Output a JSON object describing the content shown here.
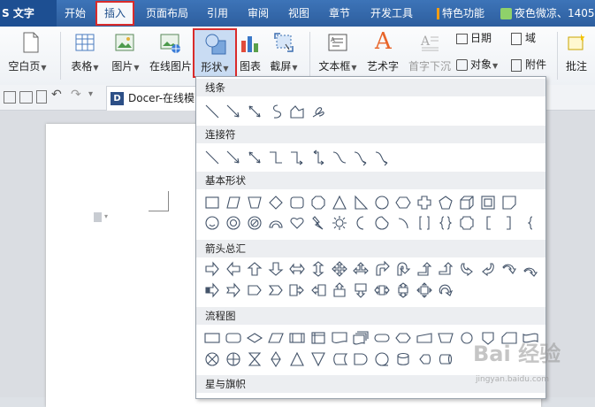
{
  "app": {
    "name": "S 文字"
  },
  "menu": {
    "tabs": [
      "开始",
      "插入",
      "页面布局",
      "引用",
      "审阅",
      "视图",
      "章节",
      "开发工具",
      "特色功能"
    ],
    "active_tab": "插入",
    "user": "夜色微凉、1405"
  },
  "ribbon": {
    "blank_page": "空白页",
    "table": "表格",
    "picture": "图片",
    "online_picture": "在线图片",
    "shape": "形状",
    "chart": "图表",
    "screenshot": "截屏",
    "textbox": "文本框",
    "wordart": "艺术字",
    "drop_cap": "首字下沉",
    "date": "日期",
    "field": "域",
    "object": "对象",
    "attachment": "附件",
    "comment": "批注",
    "wordart_glyph": "A"
  },
  "toolbar2": {
    "doc_tab": "Docer-在线模"
  },
  "dropdown": {
    "sections": [
      "线条",
      "连接符",
      "基本形状",
      "箭头总汇",
      "流程图",
      "星与旗帜"
    ]
  },
  "watermark": {
    "brand": "Bai 经验",
    "url": "jingyan.baidu.com"
  },
  "colors": {
    "menubar": "#2d5e9e",
    "highlight_border": "#d92b2b",
    "accent_orange": "#f39c12"
  }
}
